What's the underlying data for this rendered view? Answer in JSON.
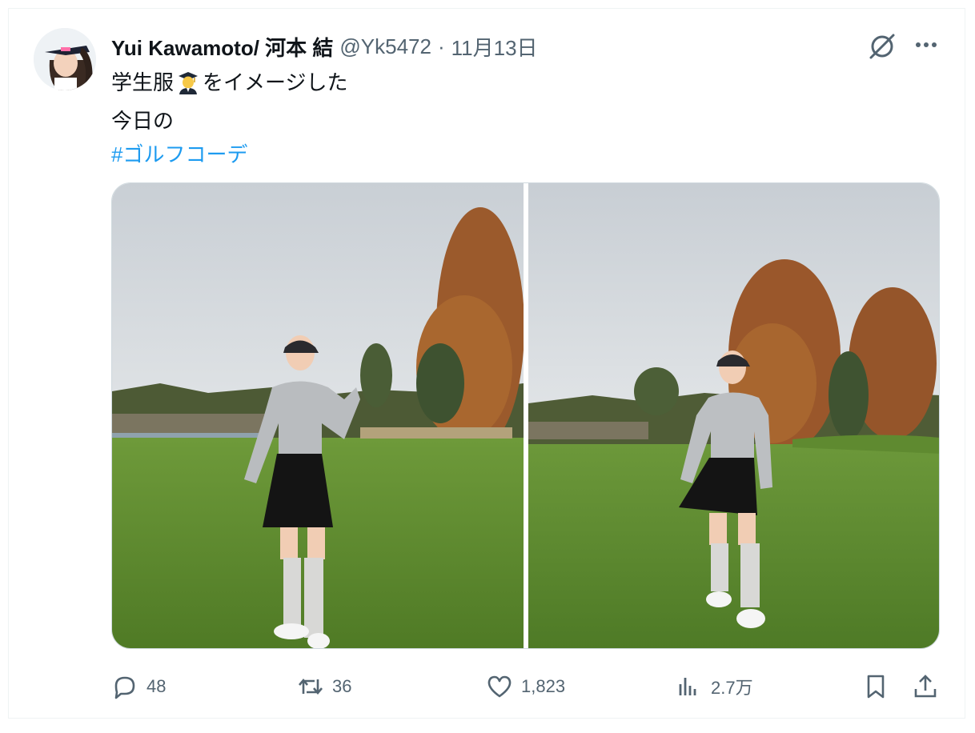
{
  "author": {
    "name": "Yui Kawamoto/ 河本 結",
    "handle": "@Yk5472",
    "separator": "·",
    "date": "11月13日"
  },
  "tweet": {
    "line1_pre": "学生服",
    "line1_emoji": "student-emoji",
    "line1_post": "をイメージした",
    "line2": "今日の",
    "hashtag": "#ゴルフコーデ"
  },
  "media": [
    {
      "icon": "photo-golfer-left"
    },
    {
      "icon": "photo-golfer-right"
    }
  ],
  "actions": {
    "replies": "48",
    "reposts": "36",
    "likes": "1,823",
    "views": "2.7万"
  },
  "colors": {
    "text": "#0f1419",
    "secondary": "#536471",
    "link": "#1d9bf0",
    "border": "#eff3f4"
  },
  "icons": [
    "grok-icon",
    "more-icon",
    "reply-icon",
    "repost-icon",
    "like-icon",
    "views-icon",
    "bookmark-icon",
    "share-icon"
  ]
}
